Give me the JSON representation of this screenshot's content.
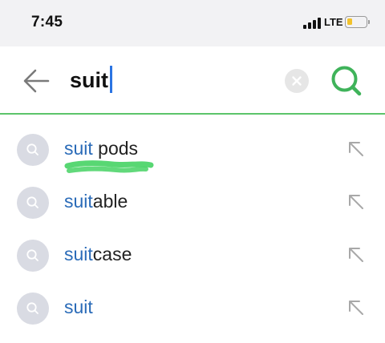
{
  "status_bar": {
    "time": "7:45",
    "network": "LTE",
    "battery_level": 0.3,
    "battery_color": "#f2c22b"
  },
  "search": {
    "query": "suit",
    "accent_color": "#5cc46a",
    "back_icon": "arrow-left-icon",
    "clear_icon": "clear-x-icon",
    "search_icon": "search-icon"
  },
  "suggestions": [
    {
      "match": "suit",
      "rest": " pods",
      "redacted": true
    },
    {
      "match": "suit",
      "rest": "able"
    },
    {
      "match": "suit",
      "rest": "case"
    },
    {
      "match": "suit",
      "rest": ""
    }
  ],
  "colors": {
    "match_text": "#2a6bb8",
    "caret": "#2b74e2"
  }
}
